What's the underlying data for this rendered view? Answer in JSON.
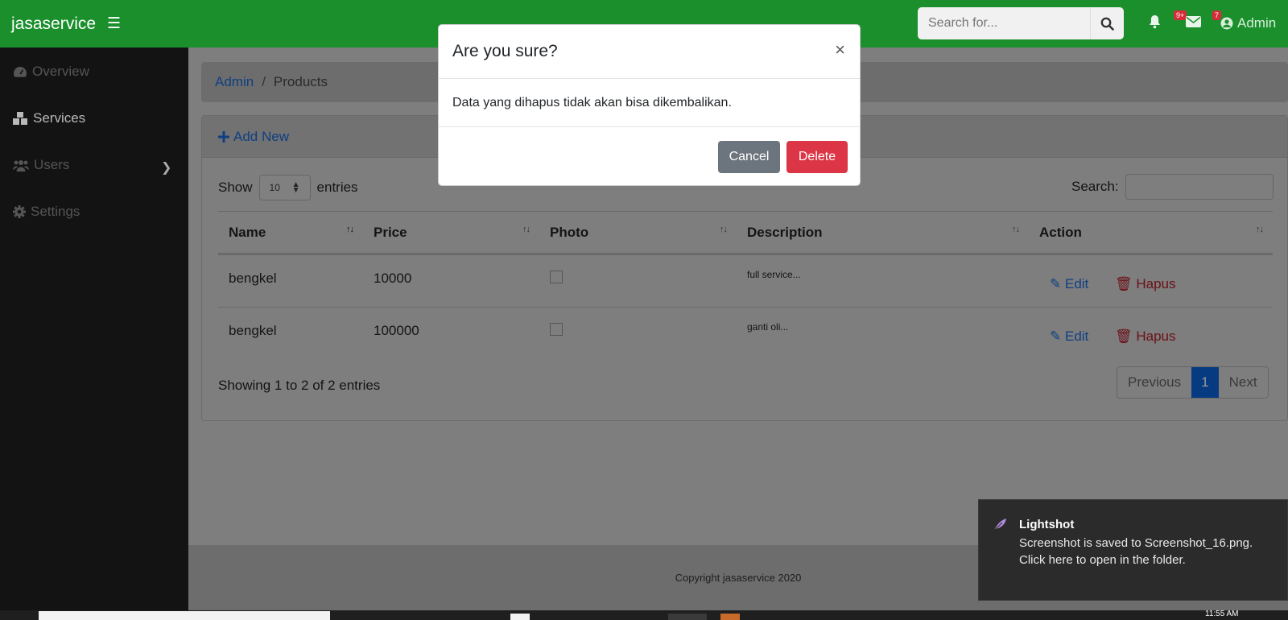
{
  "navbar": {
    "brand": "jasaservice",
    "search_placeholder": "Search for...",
    "alerts_badge": "9+",
    "messages_badge": "7",
    "user_label": "Admin"
  },
  "sidebar": {
    "items": [
      {
        "label": "Overview",
        "icon": "tachometer-icon"
      },
      {
        "label": "Services",
        "icon": "cubes-icon"
      },
      {
        "label": "Users",
        "icon": "users-icon"
      },
      {
        "label": "Settings",
        "icon": "cog-icon"
      }
    ]
  },
  "breadcrumb": {
    "root": "Admin",
    "separator": "/",
    "current": "Products"
  },
  "card": {
    "add_new": "Add New"
  },
  "datatable": {
    "show_label": "Show",
    "page_length": "10",
    "entries_label": "entries",
    "search_label": "Search:",
    "columns": [
      "Name",
      "Price",
      "Photo",
      "Description",
      "Action"
    ],
    "rows": [
      {
        "name": "bengkel",
        "price": "10000",
        "description": "full service..."
      },
      {
        "name": "bengkel",
        "price": "100000",
        "description": "ganti oli..."
      }
    ],
    "edit_label": "Edit",
    "delete_label": "Hapus",
    "info": "Showing 1 to 2 of 2 entries",
    "pagination": {
      "previous": "Previous",
      "page": "1",
      "next": "Next"
    }
  },
  "footer": {
    "copyright": "Copyright jasaservice 2020"
  },
  "modal": {
    "title": "Are you sure?",
    "close": "×",
    "body": "Data yang dihapus tidak akan bisa dikembalikan.",
    "cancel": "Cancel",
    "delete": "Delete"
  },
  "toast": {
    "title": "Lightshot",
    "message": "Screenshot is saved to Screenshot_16.png. Click here to open in the folder."
  },
  "taskbar": {
    "clock": "11:55 AM"
  },
  "colors": {
    "navbar": "#1a8f2c",
    "sidebar": "#131313",
    "danger": "#dc3545",
    "secondary": "#6c757d",
    "primary": "#0d6efd"
  }
}
